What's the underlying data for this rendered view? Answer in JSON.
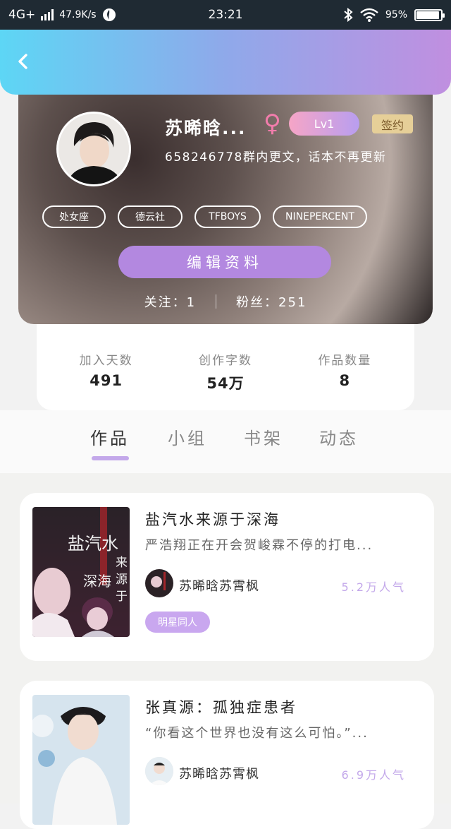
{
  "status_bar": {
    "network": "4G+",
    "speed": "47.9K/s",
    "time": "23:21",
    "battery": "95%",
    "battery_level": 0.95
  },
  "header": {
    "back_icon": "chevron-left-icon"
  },
  "profile": {
    "name": "苏晞晗...",
    "gender_icon": "female-icon",
    "level": "Lv1",
    "signed_label": "签约",
    "bio": "658246778群内更文，话本不再更新",
    "tags": [
      "处女座",
      "德云社",
      "TFBOYS",
      "NINEPERCENT"
    ],
    "edit_button": "编辑资料",
    "following": "关注：1",
    "followers": "粉丝：251"
  },
  "stats": [
    {
      "label": "加入天数",
      "value": "491"
    },
    {
      "label": "创作字数",
      "value": "54万"
    },
    {
      "label": "作品数量",
      "value": "8"
    }
  ],
  "tabs": [
    {
      "label": "作品",
      "active": true
    },
    {
      "label": "小组",
      "active": false
    },
    {
      "label": "书架",
      "active": false
    },
    {
      "label": "动态",
      "active": false
    }
  ],
  "works": [
    {
      "title": "盐汽水来源于深海",
      "description": "严浩翔正在开会贺峻霖不停的打电...",
      "author": "苏晞晗苏霄枫",
      "popularity": "5.2万人气",
      "tag": "明星同人",
      "cover_text": [
        "盐汽水",
        "来",
        "源",
        "深海",
        "于"
      ]
    },
    {
      "title": "张真源：孤独症患者",
      "description": "“你看这个世界也没有这么可怕。”...",
      "author": "苏晞晗苏霄枫",
      "popularity": "6.9万人气"
    }
  ],
  "colors": {
    "accent_purple": "#b388e0",
    "popularity_purple": "#c3a8ea",
    "female_pink": "#f27dac"
  }
}
